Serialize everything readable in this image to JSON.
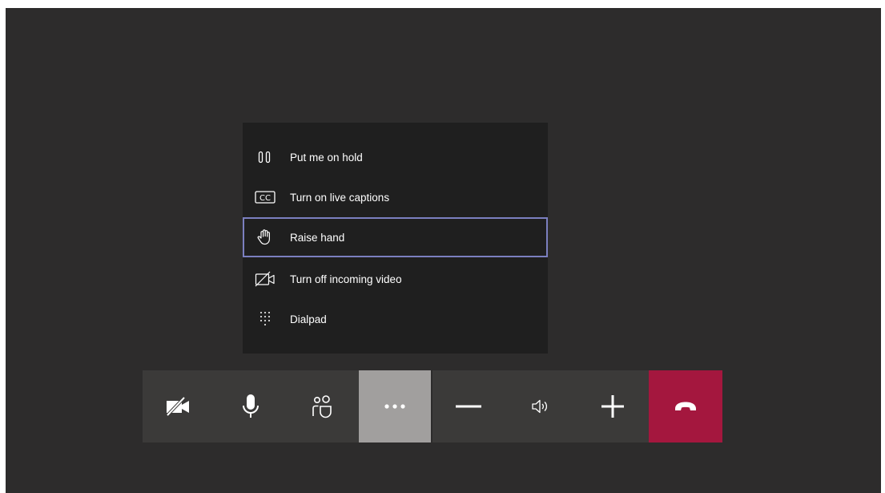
{
  "menu": {
    "items": [
      {
        "label": "Put me on hold",
        "icon": "pause-icon",
        "focused": false
      },
      {
        "label": "Turn on live captions",
        "icon": "cc-icon",
        "focused": false
      },
      {
        "label": "Raise hand",
        "icon": "hand-icon",
        "focused": true
      },
      {
        "label": "Turn off incoming video",
        "icon": "video-off-icon",
        "focused": false
      },
      {
        "label": "Dialpad",
        "icon": "dialpad-icon",
        "focused": false
      }
    ]
  },
  "toolbar": {
    "buttons": [
      {
        "name": "camera-off-button",
        "icon": "camera-off-icon"
      },
      {
        "name": "microphone-button",
        "icon": "microphone-icon"
      },
      {
        "name": "participants-button",
        "icon": "participants-icon"
      },
      {
        "name": "more-actions-button",
        "icon": "more-icon",
        "active": true
      },
      {
        "name": "volume-down-button",
        "icon": "minus-icon"
      },
      {
        "name": "speaker-button",
        "icon": "speaker-icon"
      },
      {
        "name": "volume-up-button",
        "icon": "plus-icon"
      },
      {
        "name": "hang-up-button",
        "icon": "hang-up-icon"
      }
    ]
  },
  "colors": {
    "stage_background": "#2d2c2c",
    "menu_background": "#1f1f1f",
    "toolbar_background": "#3b3a39",
    "active_button": "#a19f9e",
    "hang_up": "#a4173e",
    "focus_outline": "#7b7fbf"
  }
}
